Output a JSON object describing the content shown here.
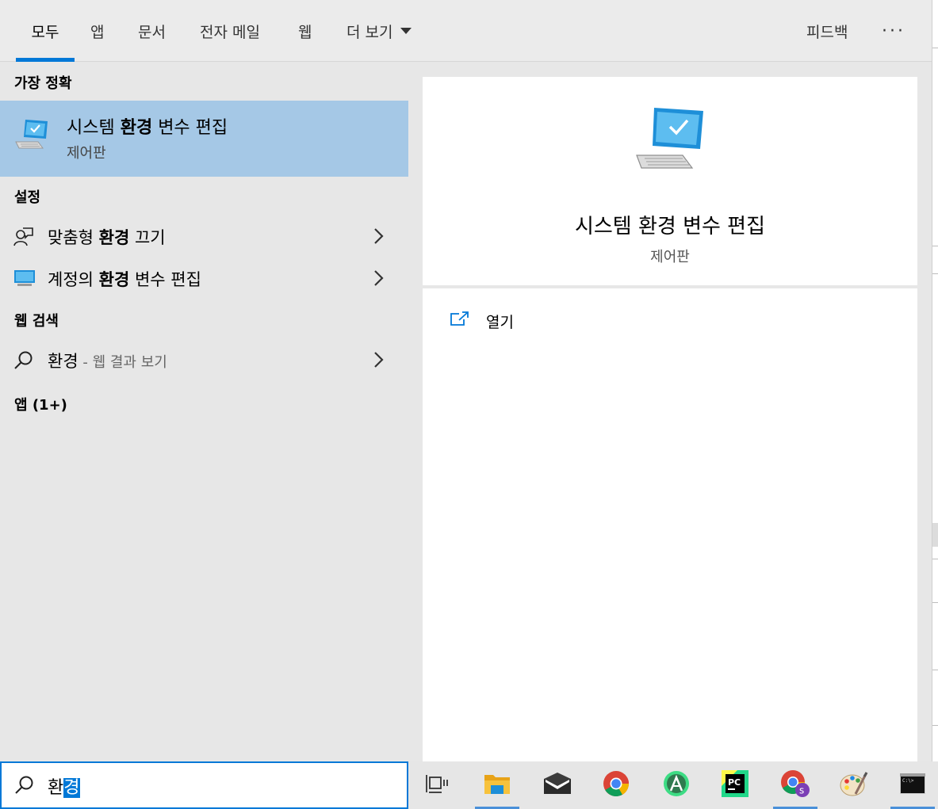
{
  "tabs": [
    {
      "label": "모두",
      "active": true
    },
    {
      "label": "앱"
    },
    {
      "label": "문서"
    },
    {
      "label": "전자 메일"
    },
    {
      "label": "웹"
    },
    {
      "label": "더 보기"
    }
  ],
  "header_right": {
    "feedback": "피드백",
    "more": "···"
  },
  "left": {
    "best_match_heading": "가장 정확",
    "best_match": {
      "title_pre": "시스템 ",
      "title_bold": "환경",
      "title_post": " 변수 편집",
      "subtitle": "제어판"
    },
    "settings_heading": "설정",
    "settings": [
      {
        "pre": "맞춤형 ",
        "bold": "환경",
        "post": " 끄기"
      },
      {
        "pre": "계정의 ",
        "bold": "환경",
        "post": " 변수 편집"
      }
    ],
    "web_heading": "웹 검색",
    "web": {
      "query": "환경",
      "suffix": " - 웹 결과 보기"
    },
    "apps_heading": "앱 (1+)"
  },
  "preview": {
    "title": "시스템 환경 변수 편집",
    "subtitle": "제어판",
    "action_open": "열기"
  },
  "search": {
    "typed": "환",
    "composing": "경"
  },
  "taskbar": [
    {
      "name": "task-view",
      "active": false
    },
    {
      "name": "file-explorer",
      "active": true
    },
    {
      "name": "mail",
      "active": false
    },
    {
      "name": "chrome",
      "active": false
    },
    {
      "name": "android-studio",
      "active": false
    },
    {
      "name": "pycharm",
      "active": false
    },
    {
      "name": "chrome-profile",
      "active": true
    },
    {
      "name": "paint",
      "active": false
    },
    {
      "name": "command-prompt",
      "active": true
    }
  ],
  "colors": {
    "accent": "#0078d7",
    "selected_row": "#a5c8e6"
  }
}
